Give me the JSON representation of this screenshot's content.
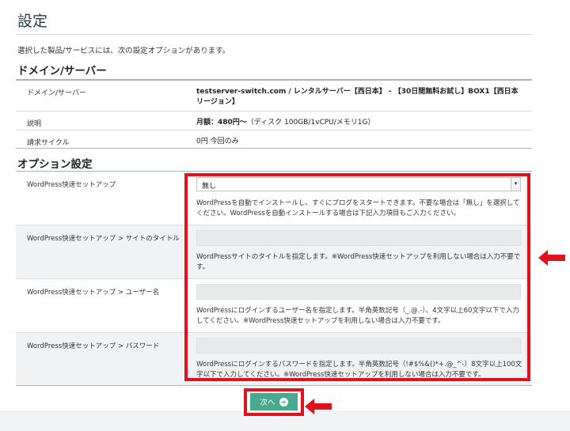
{
  "page": {
    "title": "設定",
    "intro": "選択した製品/サービスには、次の設定オプションがあります。"
  },
  "domain_section": {
    "heading": "ドメイン/サーバー",
    "rows": [
      {
        "label": "ドメイン/サーバー",
        "value": "testserver-switch.com / レンタルサーバー【西日本】 - 【30日間無料お試し】BOX1【西日本リージョン】"
      },
      {
        "label": "説明",
        "value_bold": "月額：480円〜",
        "value_rest": "（ディスク 100GB/1vCPU/メモリ1G）"
      },
      {
        "label": "請求サイクル",
        "value": "0円 今回のみ"
      }
    ]
  },
  "options_section": {
    "heading": "オプション設定",
    "rows": [
      {
        "label": "WordPress快速セットアップ",
        "select_value": "無し",
        "help": "WordPressを自動でインストールし、すぐにブログをスタートできます。不要な場合は「無し」を選択してください。WordPressを自動インストールする場合は下記入力項目もご入力ください。"
      },
      {
        "label": "WordPress快速セットアップ > サイトのタイトル",
        "input_value": "",
        "help": "WordPressサイトのタイトルを指定します。※WordPress快速セットアップを利用しない場合は入力不要です。"
      },
      {
        "label": "WordPress快速セットアップ > ユーザー名",
        "input_value": "",
        "help": "WordPressにログインするユーザー名を指定します。半角英数記号（_.@.-）、4文字以上60文字以下で入力してください。※WordPress快速セットアップを利用しない場合は入力不要です。"
      },
      {
        "label": "WordPress快速セットアップ > パスワード",
        "input_value": "",
        "help": "WordPressにログインするパスワードを指定します。半角英数記号（!#$%&()*+.@_^-）8文字以上100文字以下で入力してください。※WordPress快速セットアップを利用しない場合は入力不要です。"
      }
    ]
  },
  "actions": {
    "next_label": "次へ",
    "next_icon": "arrow-right-circle-icon"
  },
  "annotations": {
    "highlight_color": "#e0121c",
    "button_color": "#4aa88f"
  }
}
